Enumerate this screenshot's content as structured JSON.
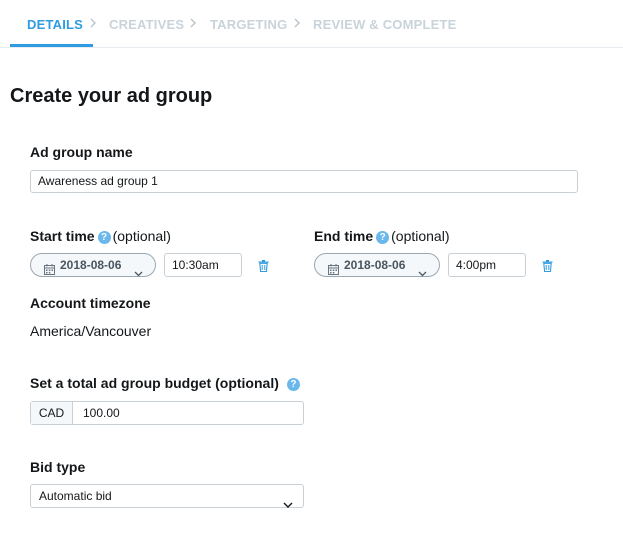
{
  "steps": [
    {
      "label": "DETAILS"
    },
    {
      "label": "CREATIVES"
    },
    {
      "label": "TARGETING"
    },
    {
      "label": "REVIEW & COMPLETE"
    }
  ],
  "active_step": "DETAILS",
  "page_title": "Create your ad group",
  "ad_group_name": {
    "label": "Ad group name",
    "value": "Awareness ad group 1"
  },
  "start_time": {
    "label": "Start time",
    "optional": "(optional)",
    "date": "2018-08-06",
    "time": "10:30am"
  },
  "end_time": {
    "label": "End time",
    "optional": "(optional)",
    "date": "2018-08-06",
    "time": "4:00pm"
  },
  "timezone": {
    "label": "Account timezone",
    "value": "America/Vancouver"
  },
  "budget": {
    "label": "Set a total ad group budget (optional)",
    "currency": "CAD",
    "amount": "100.00"
  },
  "bid_type": {
    "label": "Bid type",
    "selected": "Automatic bid"
  },
  "colors": {
    "accent": "#2f9be0",
    "help_icon": "#6ab7ec",
    "inactive_step": "#c8d3da",
    "text": "#14171a"
  },
  "icons": [
    "chevron-right-icon",
    "help-icon",
    "calendar-icon",
    "chevron-down-icon",
    "trash-icon"
  ]
}
